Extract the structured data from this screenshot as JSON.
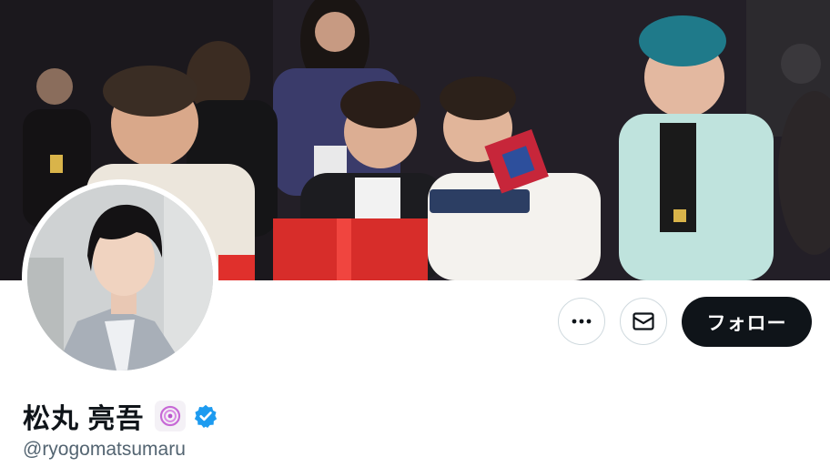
{
  "profile": {
    "display_name": "松丸 亮吾",
    "handle": "@ryogomatsumaru",
    "verified": true,
    "affiliation_badge_icon": "spiral-logo-icon"
  },
  "actions": {
    "more_icon": "more-horizontal-icon",
    "message_icon": "envelope-icon",
    "follow_label": "フォロー"
  },
  "colors": {
    "follow_bg": "#0f1419",
    "follow_text": "#ffffff",
    "verified_blue": "#1d9bf0",
    "handle_gray": "#536471",
    "border_gray": "#cfd9de"
  }
}
